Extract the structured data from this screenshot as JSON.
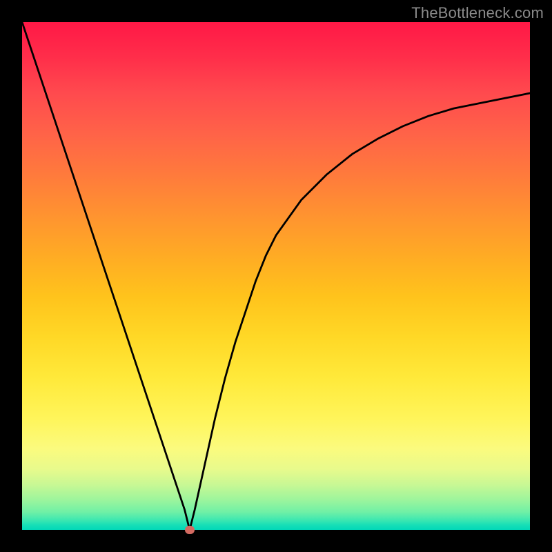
{
  "watermark": "TheBottleneck.com",
  "colors": {
    "frame": "#000000",
    "gradient_top": "#ff1846",
    "gradient_bottom": "#00d8b8",
    "curve": "#000000",
    "marker": "#d46a61"
  },
  "chart_data": {
    "type": "line",
    "title": "",
    "xlabel": "",
    "ylabel": "",
    "xlim": [
      0,
      100
    ],
    "ylim": [
      0,
      100
    ],
    "x": [
      0,
      2,
      4,
      6,
      8,
      10,
      12,
      14,
      16,
      18,
      20,
      22,
      24,
      26,
      28,
      30,
      32,
      33,
      34,
      36,
      38,
      40,
      42,
      44,
      46,
      48,
      50,
      55,
      60,
      65,
      70,
      75,
      80,
      85,
      90,
      95,
      100
    ],
    "y": [
      100,
      94,
      88,
      82,
      76,
      70,
      64,
      58,
      52,
      46,
      40,
      34,
      28,
      22,
      16,
      10,
      4,
      0,
      4,
      13,
      22,
      30,
      37,
      43,
      49,
      54,
      58,
      65,
      70,
      74,
      77,
      79.5,
      81.5,
      83,
      84,
      85,
      86
    ],
    "marker": {
      "x": 33,
      "y": 0
    }
  }
}
